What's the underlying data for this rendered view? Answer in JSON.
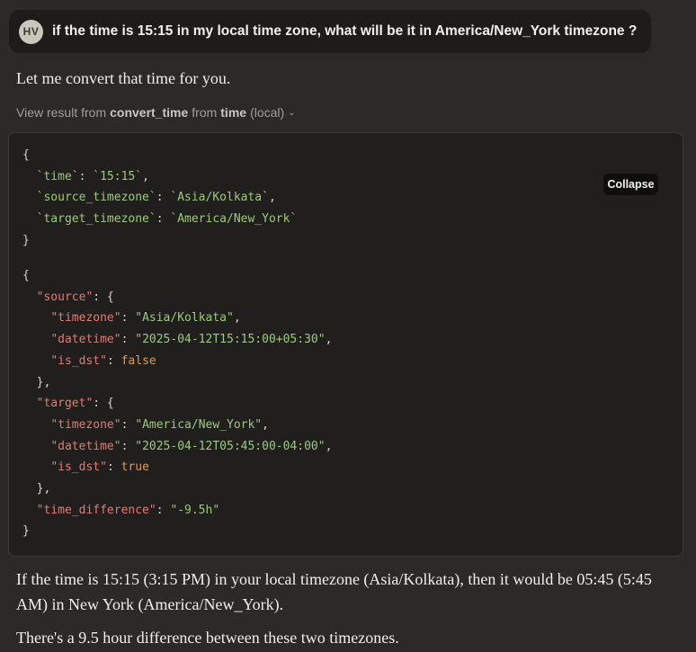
{
  "user_message": {
    "avatar_initials": "HV",
    "text": "if the time is 15:15 in my local time zone, what will be it in America/New_York timezone ?"
  },
  "assistant": {
    "intro": "Let me convert that time for you.",
    "tool_call": {
      "prefix": "View result from",
      "tool_name": "convert_time",
      "from_word": "from",
      "server_name": "time",
      "server_suffix": "(local)"
    },
    "collapse_label": "Collapse",
    "args": {
      "time_key": "`time`",
      "time_val": "`15:15`",
      "source_key": "`source_timezone`",
      "source_val": "`Asia/Kolkata`",
      "target_key": "`target_timezone`",
      "target_val": "`America/New_York`"
    },
    "result": {
      "source_key": "\"source\"",
      "target_key": "\"target\"",
      "timezone_key": "\"timezone\"",
      "datetime_key": "\"datetime\"",
      "is_dst_key": "\"is_dst\"",
      "source_timezone": "\"Asia/Kolkata\"",
      "source_datetime": "\"2025-04-12T15:15:00+05:30\"",
      "source_is_dst": "false",
      "target_timezone": "\"America/New_York\"",
      "target_datetime": "\"2025-04-12T05:45:00-04:00\"",
      "target_is_dst": "true",
      "time_difference_key": "\"time_difference\"",
      "time_difference": "\"-9.5h\""
    },
    "answer": "If the time is 15:15 (3:15 PM) in your local timezone (Asia/Kolkata), then it would be 05:45 (5:45 AM) in New York (America/New_York).",
    "summary": "There's a 9.5 hour difference between these two timezones."
  }
}
